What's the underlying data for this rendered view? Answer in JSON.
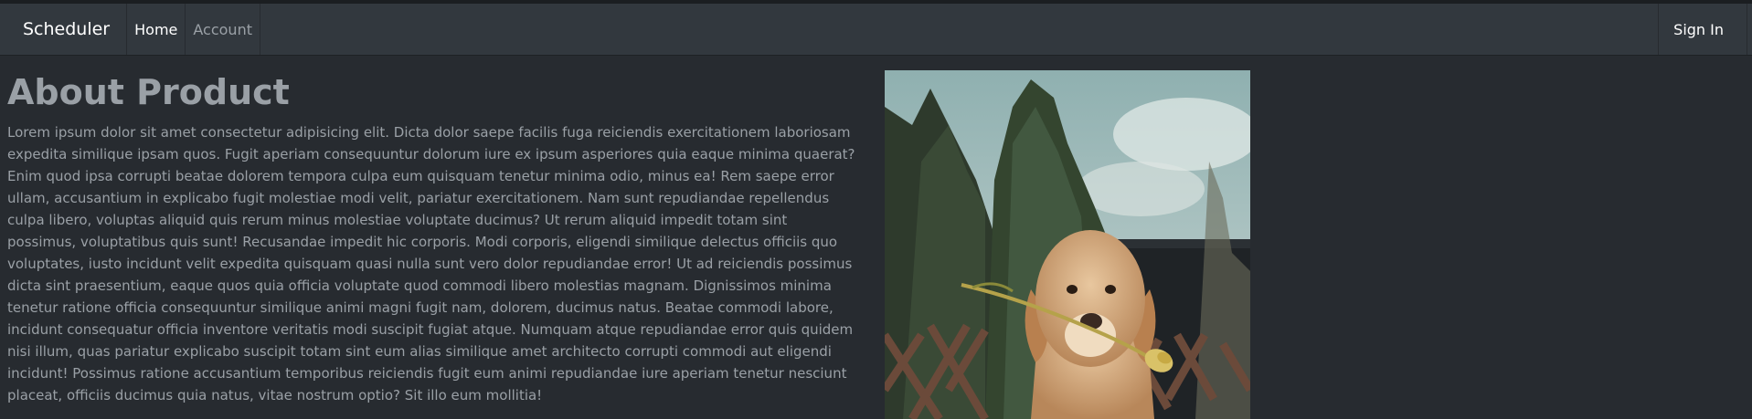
{
  "navbar": {
    "brand": "Scheduler",
    "items": [
      {
        "label": "Home",
        "active": true
      },
      {
        "label": "Account",
        "active": false
      }
    ],
    "sign_in_label": "Sign In"
  },
  "main": {
    "title": "About Product",
    "body": "Lorem ipsum dolor sit amet consectetur adipisicing elit. Dicta dolor saepe facilis fuga reiciendis exercitationem laboriosam expedita similique ipsam quos. Fugit aperiam consequuntur dolorum iure ex ipsum asperiores quia eaque minima quaerat? Enim quod ipsa corrupti beatae dolorem tempora culpa eum quisquam tenetur minima odio, minus ea! Rem saepe error ullam, accusantium in explicabo fugit molestiae modi velit, pariatur exercitationem. Nam sunt repudiandae repellendus culpa libero, voluptas aliquid quis rerum minus molestiae voluptate ducimus? Ut rerum aliquid impedit totam sint possimus, voluptatibus quis sunt! Recusandae impedit hic corporis. Modi corporis, eligendi similique delectus officiis quo voluptates, iusto incidunt velit expedita quisquam quasi nulla sunt vero dolor repudiandae error! Ut ad reiciendis possimus dicta sint praesentium, eaque quos quia officia voluptate quod commodi libero molestias magnam. Dignissimos minima tenetur ratione officia consequuntur similique animi magni fugit nam, dolorem, ducimus natus. Beatae commodi labore, incidunt consequatur officia inventore veritatis modi suscipit fugiat atque. Numquam atque repudiandae error quis quidem nisi illum, quas pariatur explicabo suscipit totam sint eum alias similique amet architecto corrupti commodi aut eligendi incidunt! Possimus ratione accusantium temporibus reiciendis fugit eum animi repudiandae iure aperiam tenetur nesciunt placeat, officiis ducimus quia natus, vitae nostrum optio? Sit illo eum mollitia!"
  },
  "colors": {
    "background": "#272b30",
    "navbar": "#32383e",
    "text_muted": "#9aa0a6",
    "text_light": "#ffffff"
  }
}
